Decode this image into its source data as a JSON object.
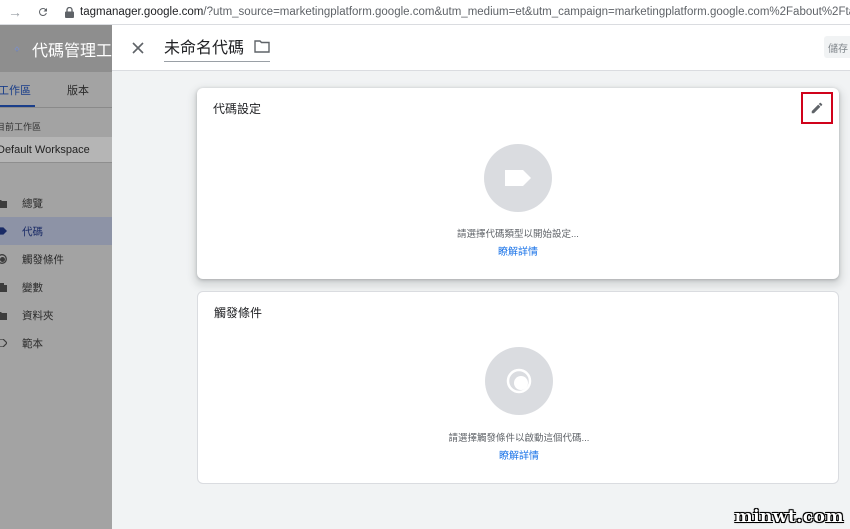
{
  "browser": {
    "url_host": "tagmanager.google.com",
    "url_rest": "/?utm_source=marketingplatform.google.com&utm_medium=et&utm_campaign=marketingplatform.google.com%2Fabout%2Ftag-manager%..."
  },
  "sidebar": {
    "app_title": "代碼管理工",
    "tabs": [
      {
        "label": "工作區",
        "active": true
      },
      {
        "label": "版本",
        "active": false
      }
    ],
    "workspace_label": "目前工作區",
    "workspace_value": "Default Workspace",
    "items": [
      {
        "label": "總覽",
        "icon": "folder-icon",
        "active": false
      },
      {
        "label": "代碼",
        "icon": "tag-icon",
        "active": true
      },
      {
        "label": "觸發條件",
        "icon": "trigger-icon",
        "active": false
      },
      {
        "label": "變數",
        "icon": "variables-icon",
        "active": false
      },
      {
        "label": "資料夾",
        "icon": "folder-icon",
        "active": false
      },
      {
        "label": "範本",
        "icon": "template-icon",
        "active": false
      }
    ]
  },
  "panel": {
    "title": "未命名代碼",
    "save_label": "儲存",
    "tag_card": {
      "title": "代碼設定",
      "hint": "請選擇代碼類型以開始設定...",
      "learn_more": "瞭解詳情"
    },
    "trigger_card": {
      "title": "觸發條件",
      "hint": "請選擇觸發條件以啟動這個代碼...",
      "learn_more": "瞭解詳情"
    }
  },
  "watermark": "minwt.com",
  "colors": {
    "accent": "#1a73e8",
    "highlight_box": "#d0021b",
    "icon_circle": "#dadce0"
  }
}
